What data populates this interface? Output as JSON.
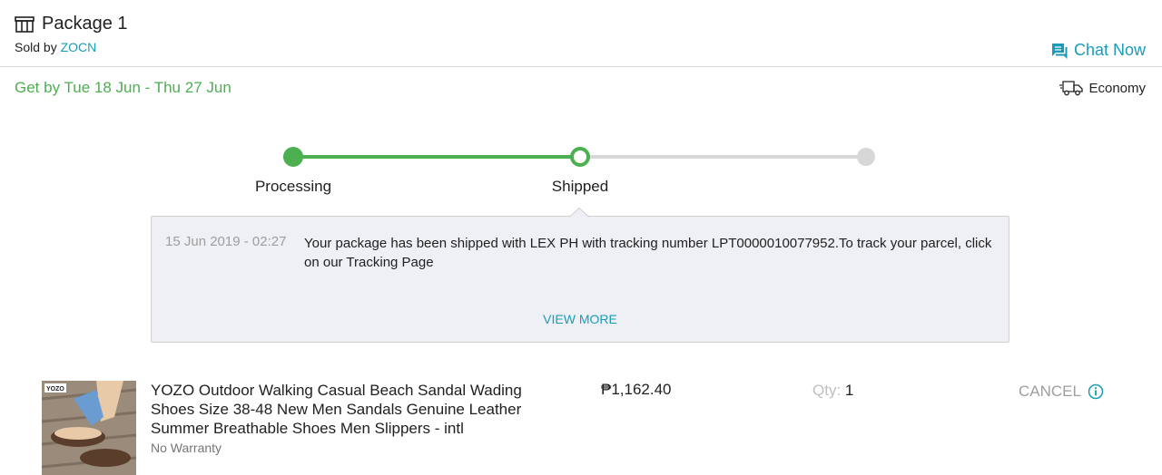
{
  "package": {
    "title": "Package 1",
    "sold_by_prefix": "Sold by ",
    "seller": "ZOCN",
    "chat_label": "Chat Now"
  },
  "delivery": {
    "estimate": "Get by Tue 18 Jun - Thu 27 Jun",
    "shipping_method": "Economy"
  },
  "tracker": {
    "steps": [
      {
        "label": "Processing",
        "state": "done"
      },
      {
        "label": "Shipped",
        "state": "current"
      },
      {
        "label": "",
        "state": "todo"
      }
    ],
    "accent": "#4caf50",
    "inactive": "#d7d7d7"
  },
  "log": {
    "time": "15 Jun 2019 - 02:27",
    "message": "Your package has been shipped with LEX PH with tracking number LPT0000010077952.To track your parcel, click on our Tracking Page",
    "view_more": "VIEW MORE"
  },
  "item": {
    "brand_mark": "YOZO",
    "name": "YOZO Outdoor Walking Casual Beach Sandal Wading Shoes Size 38-48 New Men Sandals Genuine Leather Summer Breathable Shoes Men Slippers - intl",
    "warranty": "No Warranty",
    "price": "₱1,162.40",
    "qty_label": "Qty:",
    "qty_value": "1",
    "cancel_label": "CANCEL"
  },
  "icons": {
    "package": "package-icon",
    "chat": "chat-icon",
    "truck": "truck-icon",
    "info": "info-icon"
  },
  "colors": {
    "link": "#1a9cb7",
    "success": "#4caf50",
    "panel_bg": "#eff0f5"
  }
}
